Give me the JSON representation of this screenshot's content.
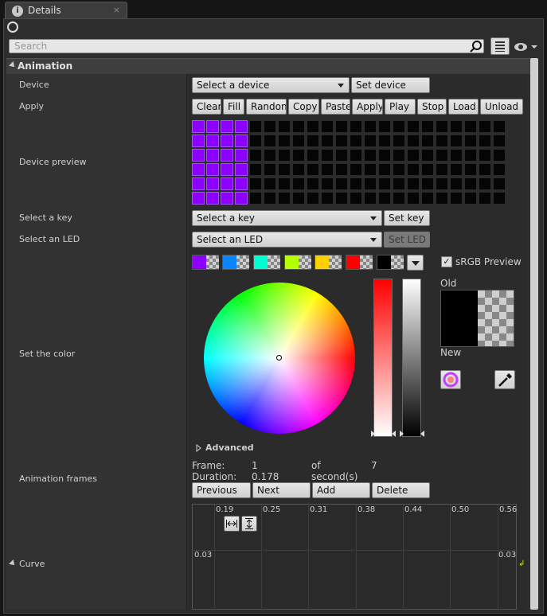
{
  "tab": {
    "icon": "info-icon",
    "title": "Details",
    "close": "×"
  },
  "search": {
    "placeholder": "Search"
  },
  "section": {
    "title": "Animation"
  },
  "rows": {
    "device": "Device",
    "apply": "Apply",
    "device_preview": "Device preview",
    "select_key": "Select a key",
    "select_led": "Select an LED",
    "set_color": "Set the color",
    "animation_frames": "Animation frames",
    "curve": "Curve"
  },
  "device": {
    "combo": "Select a device",
    "button": "Set device"
  },
  "apply_buttons": [
    "Clear",
    "Fill",
    "Randon",
    "Copy",
    "Paste",
    "Apply",
    "Play",
    "Stop",
    "Load",
    "Unload"
  ],
  "preview": {
    "cols": 22,
    "rows": 6,
    "lit_cols": 4,
    "lit_color": "#8c00ff"
  },
  "key": {
    "combo": "Select a key",
    "button": "Set key"
  },
  "led": {
    "combo": "Select an LED",
    "button": "Set LED"
  },
  "swatches": [
    "#8c00ff",
    "#0a84ff",
    "#00ffd0",
    "#b4ff00",
    "#ffd000",
    "#ff0000",
    "#000000"
  ],
  "color": {
    "srgb_label": "sRGB Preview",
    "srgb_checked": true,
    "old_label": "Old",
    "new_label": "New",
    "advanced": "Advanced"
  },
  "frames": {
    "frame_label": "Frame:",
    "frame_value": "1",
    "of_label": "of",
    "total": "7",
    "duration_label": "Duration:",
    "duration_value": "0.178",
    "unit": "second(s)",
    "buttons": [
      "Previous",
      "Next",
      "Add",
      "Delete"
    ]
  },
  "curve": {
    "x_ticks": [
      "0.19",
      "0.25",
      "0.31",
      "0.38",
      "0.44",
      "0.50",
      "0.56"
    ],
    "y_left": "0.03",
    "y_right": "0.03"
  }
}
